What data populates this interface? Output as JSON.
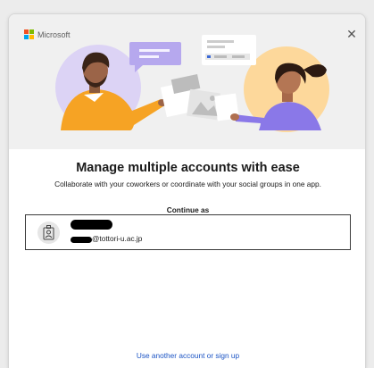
{
  "header": {
    "brand_name": "Microsoft",
    "logo_colors": [
      "#f25022",
      "#7fba00",
      "#00a4ef",
      "#ffb900"
    ],
    "close_glyph": "✕"
  },
  "main": {
    "title": "Manage multiple accounts with ease",
    "subtitle": "Collaborate with your coworkers or coordinate with your social groups in one app.",
    "continue_label": "Continue as"
  },
  "account": {
    "email_domain": "@tottori-u.ac.jp",
    "avatar_icon": "badge-icon"
  },
  "footer": {
    "link_label": "Use another account or sign up"
  },
  "colors": {
    "link": "#1a53c4",
    "hero_bg": "#f0f0f0",
    "tile_border": "#3b3b3b"
  }
}
